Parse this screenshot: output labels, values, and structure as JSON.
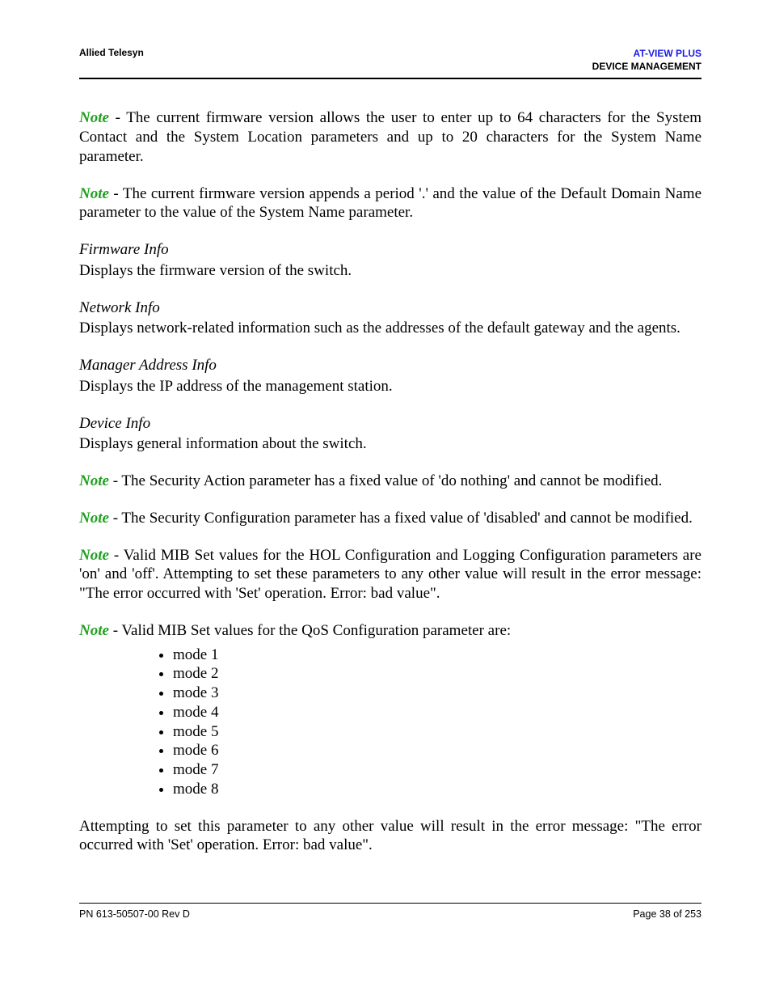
{
  "header": {
    "left": "Allied Telesyn",
    "right_line1": "AT-VIEW PLUS",
    "right_line2": "DEVICE MANAGEMENT"
  },
  "notes_top": {
    "note1": " - The current firmware version allows the user to enter up to 64 characters for the System Contact and the System Location parameters and up to 20 characters for the System Name parameter.",
    "note2": " - The current firmware version appends a period '.' and the value of the Default Domain Name parameter to the value of the System Name parameter."
  },
  "sections": {
    "firmware": {
      "title": "Firmware Info",
      "body": "Displays the firmware version of the switch."
    },
    "network": {
      "title": "Network Info",
      "body": "Displays network-related information such as the addresses of the default gateway and the agents."
    },
    "manager": {
      "title": "Manager Address Info",
      "body": "Displays the IP address of the management station."
    },
    "device": {
      "title": "Device Info",
      "body": "Displays general information about the switch.",
      "note1": " - The Security Action parameter has a fixed value of 'do nothing' and cannot be modified.",
      "note2": " - The Security Configuration parameter has a fixed value of 'disabled' and cannot be modified.",
      "note3": " - Valid MIB Set values for the HOL Configuration and Logging Configuration parameters are 'on' and 'off'. Attempting to set these parameters to any other value will result in the error message: \"The error occurred with 'Set' operation. Error: bad value\".",
      "note4": " - Valid MIB Set values for the QoS Configuration parameter are:",
      "modes": [
        "mode 1",
        "mode 2",
        "mode 3",
        "mode 4",
        "mode 5",
        "mode 6",
        "mode 7",
        "mode 8"
      ],
      "closing": "Attempting to set this parameter to any other value will result in the error message: \"The error occurred with 'Set' operation. Error: bad value\"."
    }
  },
  "note_label": "Note",
  "footer": {
    "left": "PN 613-50507-00 Rev D",
    "right": "Page 38 of 253"
  }
}
